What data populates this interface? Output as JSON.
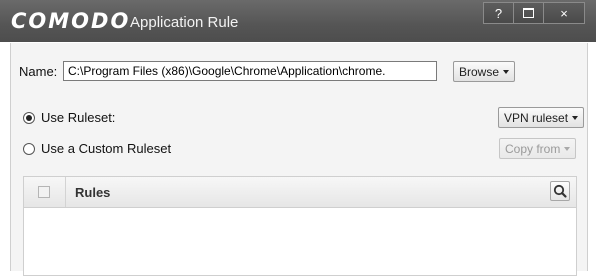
{
  "titlebar": {
    "brand": "COMODO",
    "title": "Application Rule",
    "help_label": "?",
    "close_label": "×"
  },
  "form": {
    "name_label": "Name:",
    "name_value": "C:\\Program Files (x86)\\Google\\Chrome\\Application\\chrome.",
    "browse_label": "Browse",
    "use_ruleset_label": "Use Ruleset:",
    "use_ruleset_selected": true,
    "ruleset_value": "VPN ruleset",
    "use_custom_label": "Use a Custom Ruleset",
    "use_custom_selected": false,
    "copy_from_label": "Copy from"
  },
  "table": {
    "header_rules": "Rules"
  },
  "icons": {
    "search": "search-icon",
    "maximize": "maximize-icon"
  }
}
